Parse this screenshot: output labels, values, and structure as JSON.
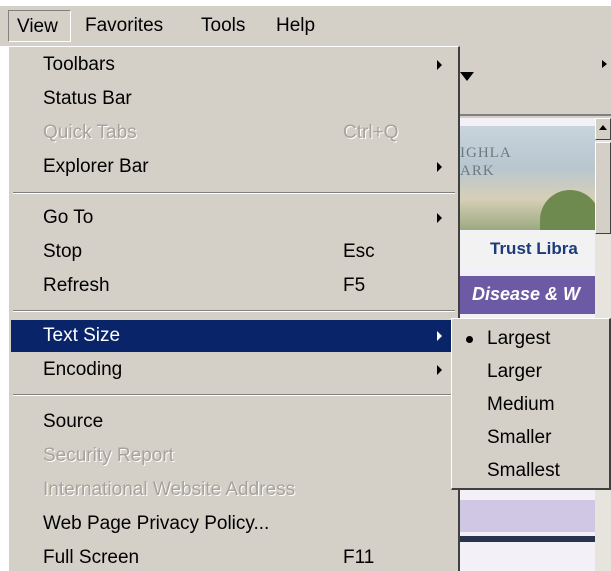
{
  "menubar": {
    "items": [
      {
        "label": "View",
        "active": true
      },
      {
        "label": "Favorites"
      },
      {
        "label": "Tools"
      },
      {
        "label": "Help"
      }
    ]
  },
  "view_menu": {
    "items": [
      {
        "label": "Toolbars",
        "submenu": true
      },
      {
        "label": "Status Bar"
      },
      {
        "label": "Quick Tabs",
        "shortcut": "Ctrl+Q",
        "disabled": true
      },
      {
        "label": "Explorer Bar",
        "submenu": true
      },
      {
        "label": "Go To",
        "submenu": true
      },
      {
        "label": "Stop",
        "shortcut": "Esc"
      },
      {
        "label": "Refresh",
        "shortcut": "F5"
      },
      {
        "label": "Text Size",
        "submenu": true,
        "selected": true
      },
      {
        "label": "Encoding",
        "submenu": true
      },
      {
        "label": "Source"
      },
      {
        "label": "Security Report",
        "disabled": true
      },
      {
        "label": "International Website Address",
        "disabled": true
      },
      {
        "label": "Web Page Privacy Policy..."
      },
      {
        "label": "Full Screen",
        "shortcut": "F11"
      }
    ]
  },
  "text_size_submenu": {
    "items": [
      {
        "label": "Largest",
        "checked": true
      },
      {
        "label": "Larger"
      },
      {
        "label": "Medium"
      },
      {
        "label": "Smaller"
      },
      {
        "label": "Smallest"
      }
    ]
  },
  "page_content": {
    "banner_text": "IGHLA\nARK",
    "trust_link": "Trust Libra",
    "disease_heading": "Disease & W"
  },
  "colors": {
    "menu_face": "#d4d0c8",
    "selection": "#0a246a",
    "disabled_text": "#a7a39b",
    "disease_banner": "#6c5ba4",
    "trust_text": "#1d3b7a"
  }
}
